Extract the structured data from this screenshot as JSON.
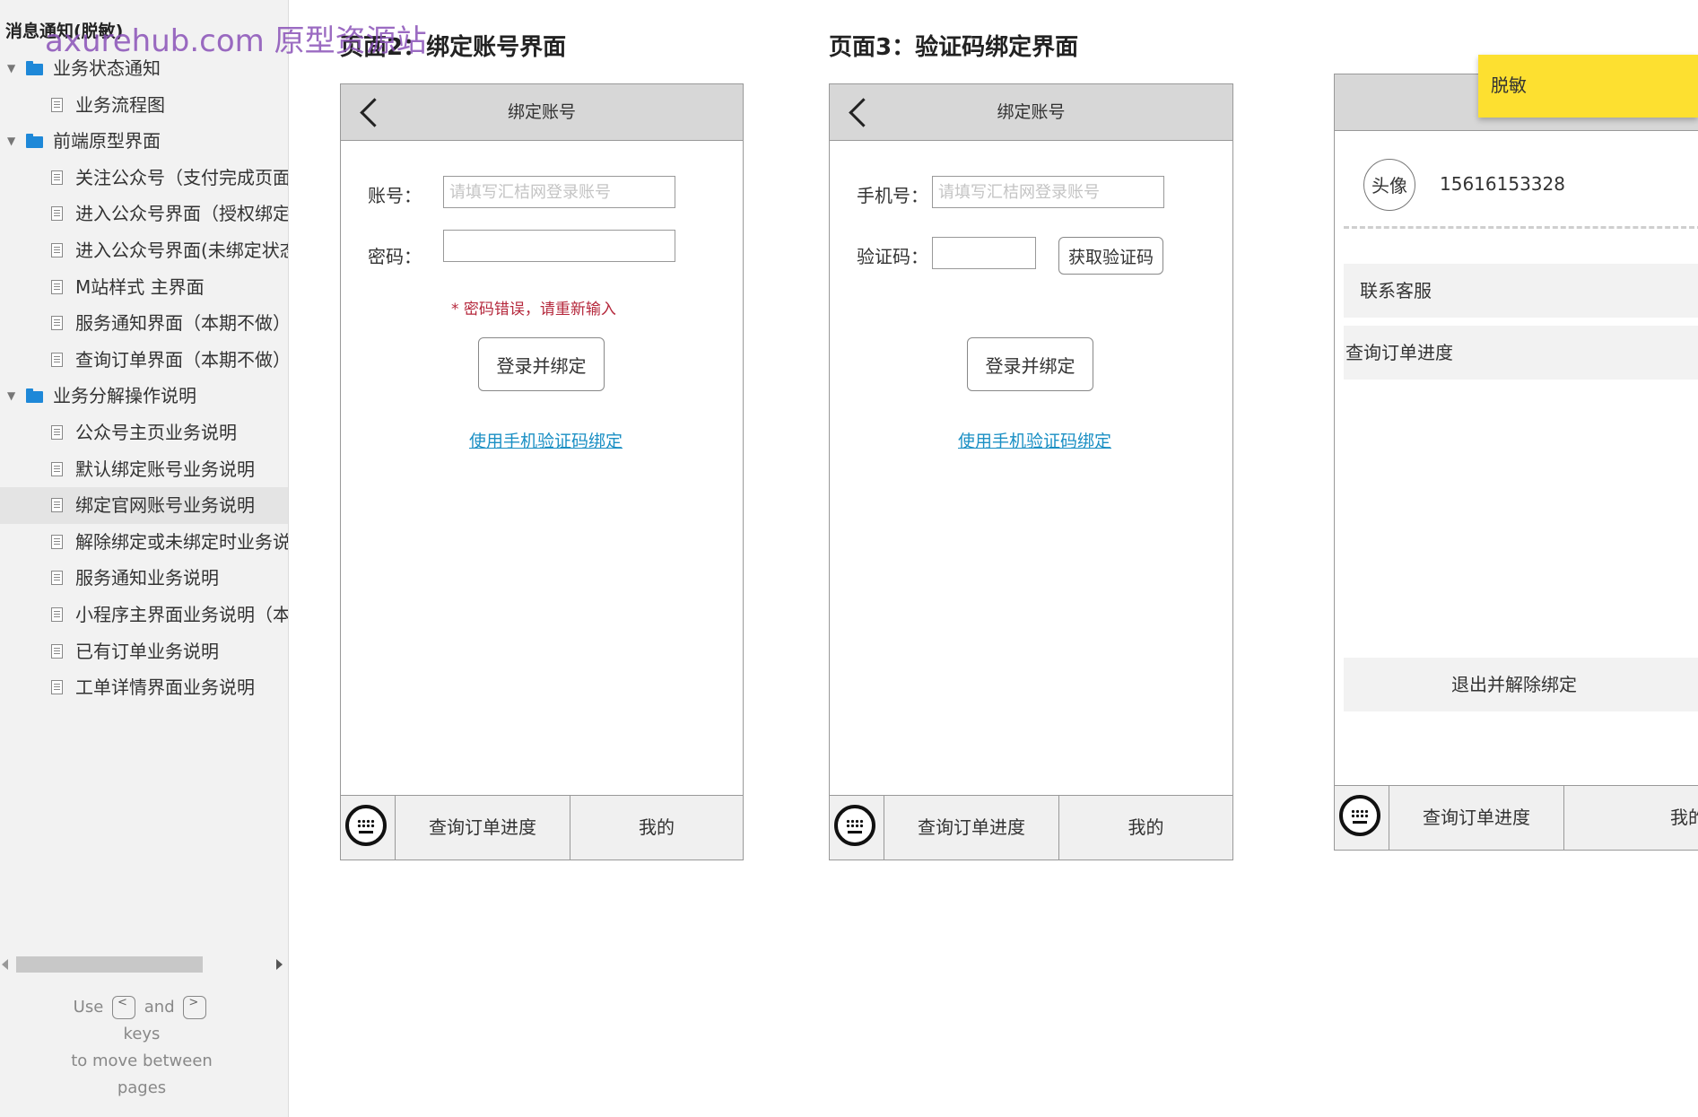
{
  "sidebar": {
    "title": "消息通知(脱敏)",
    "watermark": "axurehub.com 原型资源站",
    "items": [
      {
        "type": "folder",
        "label": "业务状态通知",
        "selected": false
      },
      {
        "type": "page",
        "label": "业务流程图",
        "selected": false
      },
      {
        "type": "folder",
        "label": "前端原型界面",
        "selected": false
      },
      {
        "type": "page",
        "label": "关注公众号（支付完成页面",
        "selected": false
      },
      {
        "type": "page",
        "label": "进入公众号界面（授权绑定",
        "selected": false
      },
      {
        "type": "page",
        "label": "进入公众号界面(未绑定状态",
        "selected": false
      },
      {
        "type": "page",
        "label": "M站样式 主界面",
        "selected": false
      },
      {
        "type": "page",
        "label": "服务通知界面（本期不做）",
        "selected": false
      },
      {
        "type": "page",
        "label": "查询订单界面（本期不做）",
        "selected": false
      },
      {
        "type": "folder",
        "label": "业务分解操作说明",
        "selected": false
      },
      {
        "type": "page",
        "label": "公众号主页业务说明",
        "selected": false
      },
      {
        "type": "page",
        "label": "默认绑定账号业务说明",
        "selected": false
      },
      {
        "type": "page",
        "label": "绑定官网账号业务说明",
        "selected": true
      },
      {
        "type": "page",
        "label": "解除绑定或未绑定时业务说明",
        "selected": false
      },
      {
        "type": "page",
        "label": "服务通知业务说明",
        "selected": false
      },
      {
        "type": "page",
        "label": "小程序主界面业务说明（本",
        "selected": false
      },
      {
        "type": "page",
        "label": "已有订单业务说明",
        "selected": false
      },
      {
        "type": "page",
        "label": "工单详情界面业务说明",
        "selected": false
      }
    ],
    "help": {
      "use": "Use",
      "prev_key": "<",
      "and": "and",
      "next_key": ">",
      "keys": "keys",
      "line2": "to move between",
      "line3": "pages"
    }
  },
  "page2": {
    "heading": "页面2：绑定账号界面",
    "header_title": "绑定账号",
    "account_label": "账号：",
    "account_placeholder": "请填写汇桔网登录账号",
    "password_label": "密码：",
    "password_value": "",
    "error": "* 密码错误，请重新输入",
    "submit_label": "登录并绑定",
    "link": "使用手机验证码绑定",
    "tab_order": "查询订单进度",
    "tab_mine": "我的"
  },
  "page3": {
    "heading": "页面3：验证码绑定界面",
    "header_title": "绑定账号",
    "phone_label": "手机号：",
    "phone_placeholder": "请填写汇桔网登录账号",
    "code_label": "验证码：",
    "code_value": "",
    "get_code_label": "获取验证码",
    "submit_label": "登录并绑定",
    "link": "使用手机验证码绑定",
    "tab_order": "查询订单进度",
    "tab_mine": "我的"
  },
  "page4": {
    "avatar": "头像",
    "phone": "15616153328",
    "menu": [
      "联系客服",
      "查询订单进度"
    ],
    "logout_label": "退出并解除绑定",
    "tab_order": "查询订单进度",
    "tab_mine": "我的",
    "sticky_note": "脱敏"
  },
  "colors": {
    "sidebar_bg": "#f2f2f2",
    "folder_icon": "#1e88d8",
    "error": "#b5283c",
    "link": "#1a8fc4",
    "sticky": "#fde030",
    "watermark": "#8a52b8"
  }
}
